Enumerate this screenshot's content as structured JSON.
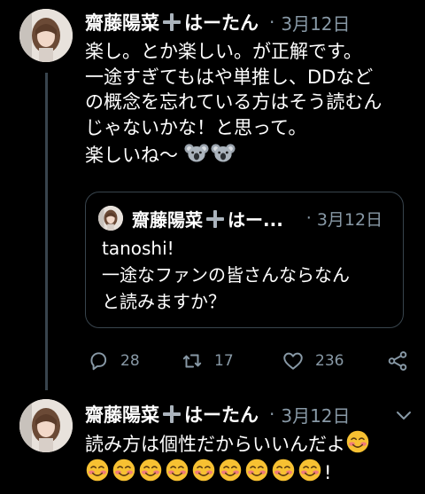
{
  "tweets": [
    {
      "author": "齋藤陽菜➕はーたん",
      "separator": "·",
      "date": "3月12日",
      "lines": [
        "楽し。とか楽しい。が正解です。",
        "一途すぎてもはや単推し、DDなど",
        "の概念を忘れている方はそう読むん",
        "じゃないかな！と思って。",
        "楽しいね〜"
      ],
      "trailing_emoji": [
        "koala-emoji",
        "koala-emoji"
      ],
      "quote": {
        "author": "齋藤陽菜➕はー...",
        "separator": "·",
        "date": "3月12日",
        "lines": [
          "tanoshi!",
          "一途なファンの皆さんならなん",
          "と読みますか？"
        ]
      },
      "actions": {
        "replies": "28",
        "retweets": "17",
        "likes": "236"
      }
    },
    {
      "author": "齋藤陽菜➕はーたん",
      "separator": "·",
      "date": "3月12日",
      "line1": "読み方は個性だからいいんだよ",
      "line2_suffix": "!",
      "emoji_line2_count": 9,
      "emoji_name": "smiling-face-emoji"
    }
  ],
  "colors": {
    "background": "#000000",
    "text": "#ffffff",
    "secondary": "#8899a6",
    "border": "#38444d"
  }
}
